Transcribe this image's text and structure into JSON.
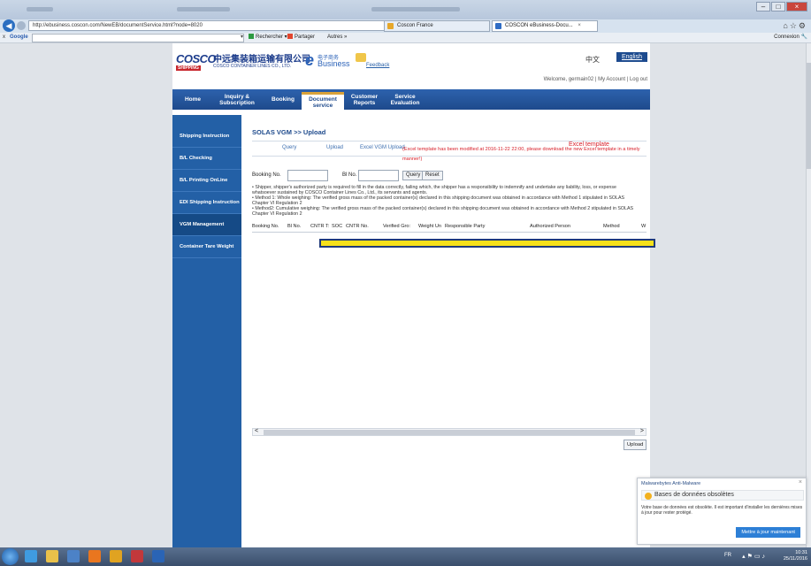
{
  "browser": {
    "url": "http://ebusiness.coscon.com/NewEB/documentService.html?node=8020",
    "tabs": [
      {
        "label": "Coscon France"
      },
      {
        "label": "COSCON eBusiness-Docu..."
      }
    ],
    "active_tab_close": "×"
  },
  "google_toolbar": {
    "close": "x",
    "logo": "Google",
    "search_label": "Rechercher",
    "share_label": "Partager",
    "more_label": "Autres »",
    "signin_label": "Connexion"
  },
  "header": {
    "logo_cosco": "COSCO",
    "logo_shipping": "SHIPPING",
    "logo_cn": "中远集装箱运输有限公司",
    "logo_en": "COSCO CONTAINER LINES CO., LTD.",
    "ebiz_cn": "电子商务",
    "ebiz_en": "Business",
    "feedback": "Feedback",
    "lang_cn": "中文",
    "lang_en": "English",
    "welcome": "Welcome, germain02 | My Account | Log out"
  },
  "menu": [
    {
      "label": "Home"
    },
    {
      "label": "Inquiry &\nSubscription"
    },
    {
      "label": "Booking"
    },
    {
      "label": "Document\nservice"
    },
    {
      "label": "Customer\nReports"
    },
    {
      "label": "Service\nEvaluation"
    }
  ],
  "sidebar": [
    {
      "label": "Shipping Instruction"
    },
    {
      "label": "B/L Checking"
    },
    {
      "label": "B/L Printing OnLine"
    },
    {
      "label": "EDI Shipping Instruction"
    },
    {
      "label": "VGM Management"
    },
    {
      "label": "Container Tare Weight"
    }
  ],
  "content": {
    "title": "SOLAS VGM >> Upload",
    "subtabs": [
      "Query",
      "Upload",
      "Excel VGM Upload"
    ],
    "notice": "(Excel template has been modified at 2016-11-22 22:00, please download the new Excel template in a timely manner!)",
    "notice_link": "Excel template",
    "booking_label": "Booking No.",
    "bl_label": "Bl No.",
    "query_btn": "Query",
    "reset_btn": "Reset",
    "rules": [
      "• Shipper, shipper's authorized party is required to fill in the data correctly, failing which, the shipper has a responsibility to indemnify and undertake any liability, loss, or expense whatsoever sustained by COSCO Container Lines Co., Ltd., its servants and agents.",
      "• Method 1: Whole weighing: The verified gross mass of the packed container(s) declared in this shipping document was obtained in accordance with Method 1 stipulated in SOLAS Chapter VI Regulation 2",
      "• Method2: Cumulative weighing: The verified gross mass of the packed container(s) declared in this shipping document was obtained in accordance with Method 2 stipulated in SOLAS Chapter VI Regulation 2"
    ],
    "columns": [
      "Booking No.",
      "Bl No.",
      "CNTR T:",
      "SOC",
      "CNTR No.",
      "Verified Gro:",
      "Weight Un",
      "Responsible Party",
      "Authorized Person",
      "Method",
      "W"
    ],
    "upload_btn": "Upload",
    "scroll_left": "<",
    "scroll_right": ">"
  },
  "popup": {
    "app": "Malwarebytes Anti-Malware",
    "close": "×",
    "title": "Bases de données obsolètes",
    "body": "Votre base de données est obsolète. Il est important d'installer les dernières mises à jour pour rester protégé.",
    "button": "Mettre à jour maintenant"
  },
  "taskbar": {
    "lang": "FR",
    "time": "10:31",
    "date": "25/11/2016"
  },
  "colors": {
    "brand_blue": "#2360a6",
    "notice_red": "#d8202a",
    "highlight": "#f6e11b"
  }
}
